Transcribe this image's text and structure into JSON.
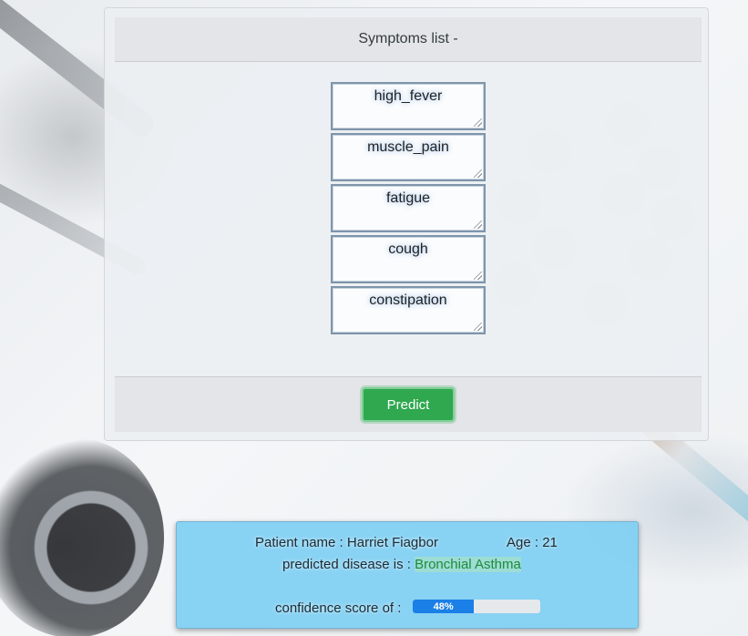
{
  "symptoms_panel": {
    "title": "Symptoms list -",
    "symptoms": [
      "high_fever",
      "muscle_pain",
      "fatigue",
      "cough",
      "constipation"
    ],
    "predict_label": "Predict"
  },
  "result": {
    "patient_label": "Patient name : ",
    "patient_name": "Harriet Fiagbor",
    "age_label": "Age : ",
    "age": "21",
    "disease_label": "predicted disease is : ",
    "disease": "Bronchial Asthma",
    "confidence_label": "confidence score of : ",
    "confidence_text": "48%",
    "confidence_value": 0.48
  },
  "colors": {
    "predict_button": "#2fa84f",
    "result_panel": "#7ccef3",
    "progress_fill": "#1a7fe6",
    "disease_text": "#1e8a3a"
  }
}
